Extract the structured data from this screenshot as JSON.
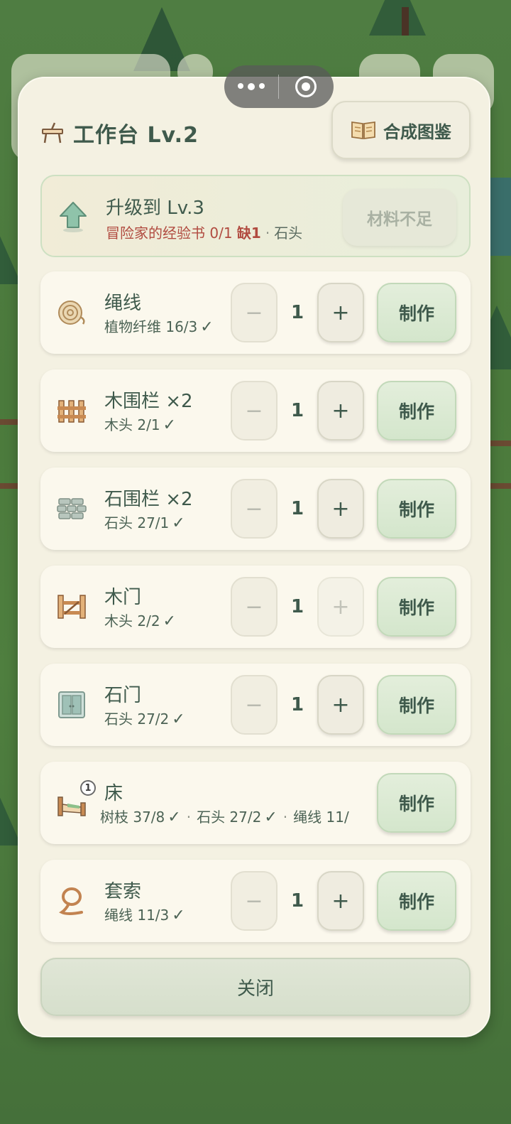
{
  "capsule": {
    "more_icon": "more-dots-icon",
    "close_icon": "miniprogram-close-icon"
  },
  "panel": {
    "title": "工作台 Lv.2",
    "title_icon": "workbench-icon",
    "guide_button": {
      "label": "合成图鉴",
      "icon": "book-icon"
    }
  },
  "upgrade": {
    "icon": "upgrade-arrow-icon",
    "title": "升级到 Lv.3",
    "req_missing_item": "冒险家的经验书 0/1",
    "req_missing_tag": "缺1",
    "req_separator": "·",
    "req_next_item": "石头",
    "button_label": "材料不足"
  },
  "recipes": [
    {
      "name": "绳线",
      "icon": "rope-coil-icon",
      "materials": "植物纤维 16/3",
      "check": "✓",
      "qty": "1",
      "make_label": "制作",
      "plus_enabled": true
    },
    {
      "name": "木围栏 ×2",
      "icon": "wood-fence-icon",
      "materials": "木头 2/1",
      "check": "✓",
      "qty": "1",
      "make_label": "制作",
      "plus_enabled": true
    },
    {
      "name": "石围栏 ×2",
      "icon": "stone-fence-icon",
      "materials": "石头 27/1",
      "check": "✓",
      "qty": "1",
      "make_label": "制作",
      "plus_enabled": true
    },
    {
      "name": "木门",
      "icon": "wood-gate-icon",
      "materials": "木头 2/2",
      "check": "✓",
      "qty": "1",
      "make_label": "制作",
      "plus_enabled": false
    },
    {
      "name": "石门",
      "icon": "stone-door-icon",
      "materials": "石头 27/2",
      "check": "✓",
      "qty": "1",
      "make_label": "制作",
      "plus_enabled": true
    }
  ],
  "bed": {
    "name": "床",
    "icon": "bed-icon",
    "badge": "1",
    "mat1": "树枝 37/8",
    "mat2": "石头 27/2",
    "mat3": "绳线 11/",
    "check": "✓",
    "separator": "·",
    "make_label": "制作"
  },
  "lasso": {
    "name": "套索",
    "icon": "lasso-icon",
    "materials": "绳线 11/3",
    "check": "✓",
    "qty": "1",
    "make_label": "制作"
  },
  "stepper": {
    "minus": "−",
    "plus": "+"
  },
  "close_label": "关闭"
}
